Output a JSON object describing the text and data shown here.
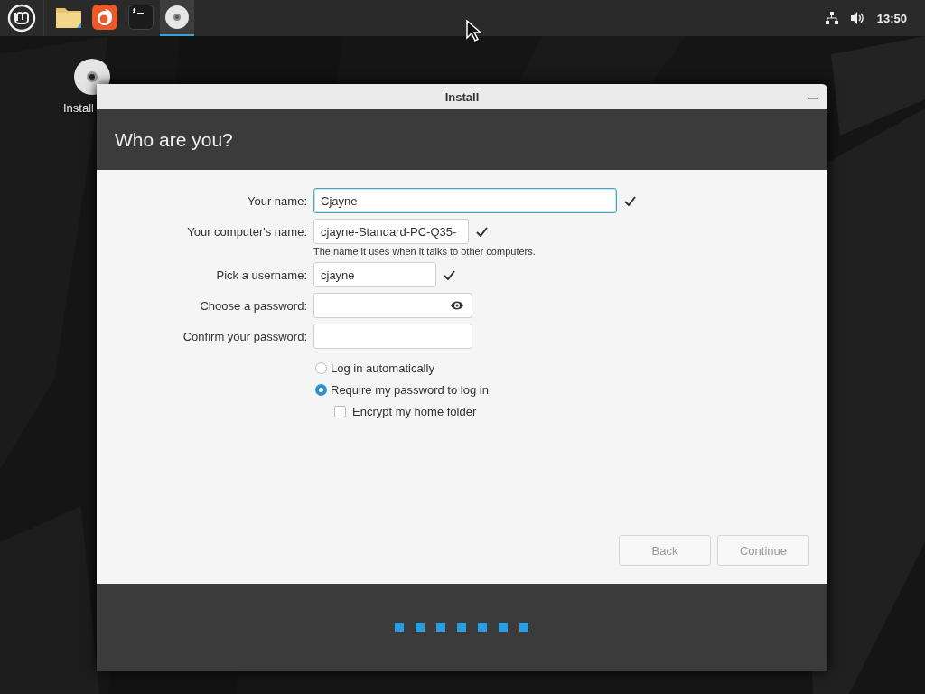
{
  "taskbar": {
    "launchers": [
      {
        "kind": "folder",
        "selected": false
      },
      {
        "kind": "browser",
        "selected": false
      },
      {
        "kind": "terminal",
        "selected": false
      },
      {
        "kind": "disc",
        "selected": true
      }
    ],
    "clock": "13:50"
  },
  "desktop_icons": [
    {
      "label": "Install"
    }
  ],
  "window": {
    "title": "Install",
    "heading": "Who are you?"
  },
  "fields": [
    {
      "kind": "text",
      "label": "Your name:",
      "value": "Cjayne",
      "focused": true,
      "valid": true
    },
    {
      "kind": "text",
      "label": "Your computer's name:",
      "value": "cjayne-Standard-PC-Q35-",
      "hint": "The name it uses when it talks to other computers.",
      "focused": false,
      "valid": true
    },
    {
      "kind": "text",
      "label": "Pick a username:",
      "value": "cjayne",
      "focused": false,
      "valid": true
    },
    {
      "kind": "password",
      "label": "Choose a password:",
      "reveal_button": true,
      "focused": false,
      "valid": false
    },
    {
      "kind": "password",
      "label": "Confirm your password:",
      "reveal_button": false,
      "focused": false,
      "valid": false
    }
  ],
  "login_options": [
    {
      "label": "Log in automatically",
      "selected": false
    },
    {
      "label": "Require my password to log in",
      "selected": true
    }
  ],
  "encrypt": {
    "label": "Encrypt my home folder",
    "checked": false
  },
  "buttons": [
    {
      "label": "Back",
      "disabled": true
    },
    {
      "label": "Continue",
      "disabled": true
    }
  ]
}
